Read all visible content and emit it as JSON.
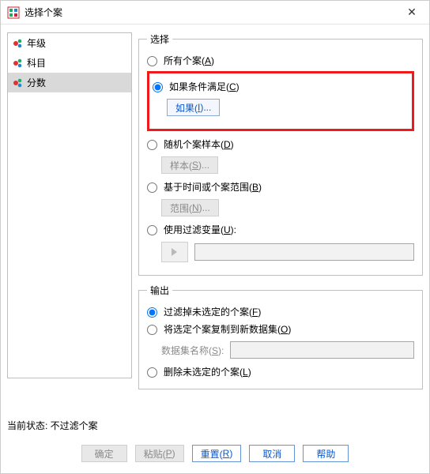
{
  "window": {
    "title": "选择个案"
  },
  "variables": {
    "items": [
      {
        "label": "年级"
      },
      {
        "label": "科目"
      },
      {
        "label": "分数"
      }
    ]
  },
  "select_group": {
    "legend": "选择",
    "opt_all": {
      "label": "所有个案(",
      "mn": "A",
      "tail": ")"
    },
    "opt_if": {
      "label": "如果条件满足(",
      "mn": "C",
      "tail": ")"
    },
    "btn_if": {
      "label": "如果(",
      "mn": "I",
      "tail": ")..."
    },
    "opt_rand": {
      "label": "随机个案样本(",
      "mn": "D",
      "tail": ")"
    },
    "btn_samp": {
      "label": "样本(",
      "mn": "S",
      "tail": ")..."
    },
    "opt_range": {
      "label": "基于时间或个案范围(",
      "mn": "B",
      "tail": ")"
    },
    "btn_range": {
      "label": "范围(",
      "mn": "N",
      "tail": ")..."
    },
    "opt_filter": {
      "label": "使用过滤变量(",
      "mn": "U",
      "tail": "):"
    },
    "filter_value": ""
  },
  "output_group": {
    "legend": "输出",
    "opt_filterout": {
      "label": "过滤掉未选定的个案(",
      "mn": "F",
      "tail": ")"
    },
    "opt_copy": {
      "label": "将选定个案复制到新数据集(",
      "mn": "O",
      "tail": ")"
    },
    "ds_label": {
      "label": "数据集名称(",
      "mn": "S",
      "tail": "):"
    },
    "ds_value": "",
    "opt_delete": {
      "label": "删除未选定的个案(",
      "mn": "L",
      "tail": ")"
    }
  },
  "status": {
    "text": "当前状态: 不过滤个案"
  },
  "buttons": {
    "ok": "确定",
    "paste": {
      "label": "粘贴(",
      "mn": "P",
      "tail": ")"
    },
    "reset": {
      "label": "重置(",
      "mn": "R",
      "tail": ")"
    },
    "cancel": "取消",
    "help": "帮助"
  }
}
